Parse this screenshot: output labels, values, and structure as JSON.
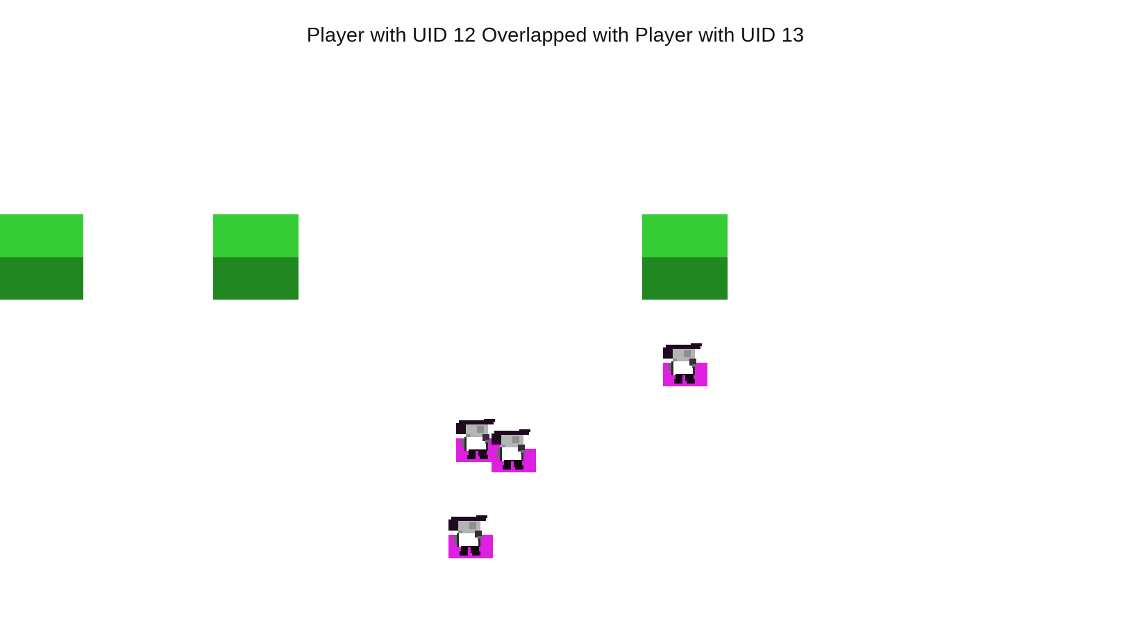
{
  "status": {
    "message": "Player with UID 12 Overlapped with Player with UID 13"
  },
  "colors": {
    "background": "#ffffff",
    "grass": "#36cc36",
    "soil": "#218721",
    "player_hitbox": "#e020e0",
    "hair": "#1e0a1e",
    "skin": "#b4b4b4",
    "shirt": "#ffffff",
    "pants": "#140514"
  },
  "tiles": [
    {
      "type": "grass-block"
    },
    {
      "type": "grass-block"
    },
    {
      "type": "grass-block"
    }
  ],
  "players": [
    {
      "sprite": "player-character"
    },
    {
      "sprite": "player-character"
    },
    {
      "sprite": "player-character"
    },
    {
      "sprite": "player-character"
    }
  ]
}
